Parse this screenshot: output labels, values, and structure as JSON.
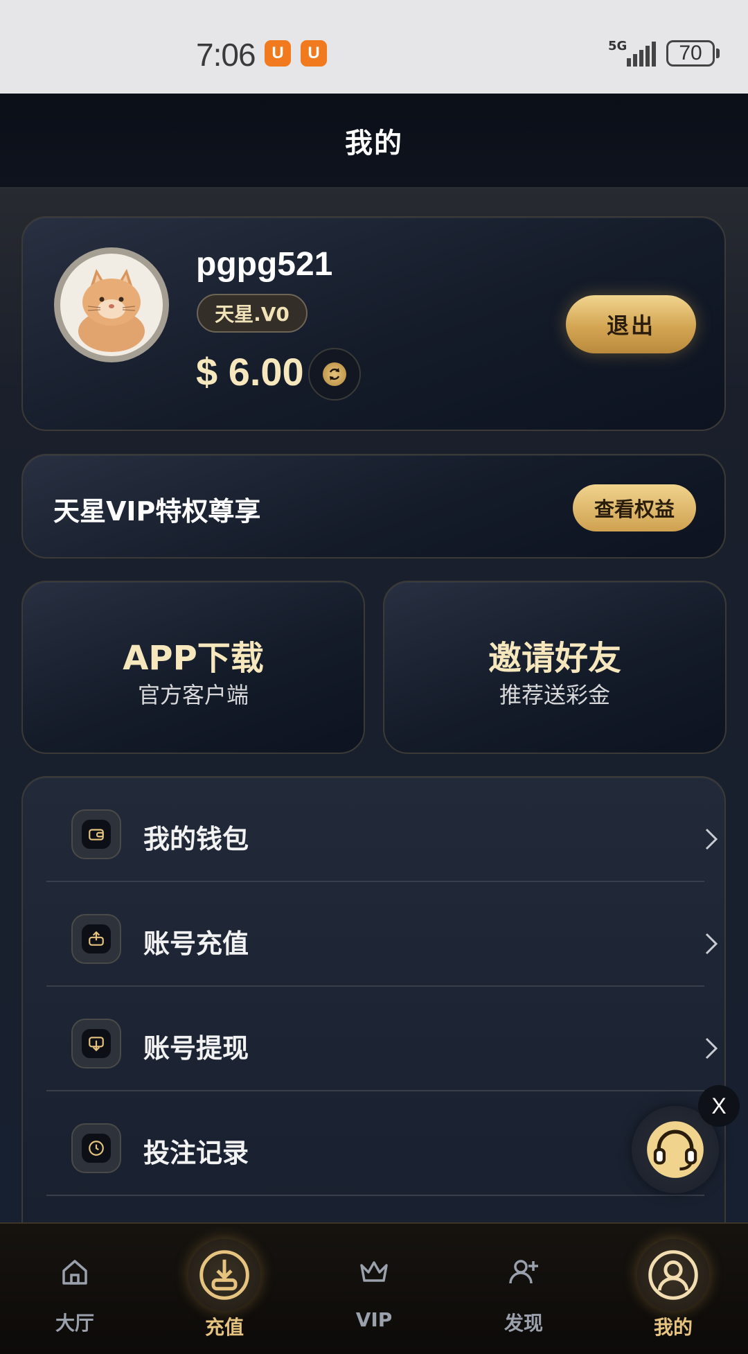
{
  "status_bar": {
    "time": "7:06",
    "app_icon_letter": "U",
    "network": "5G",
    "battery": "70"
  },
  "header": {
    "title": "我的"
  },
  "profile": {
    "username": "pgpg521",
    "level": "天星.V0",
    "balance": "$ 6.00",
    "logout_label": "退出"
  },
  "vip_banner": {
    "text": "天星VIP特权尊享",
    "button_label": "查看权益"
  },
  "tiles": [
    {
      "title": "APP下载",
      "subtitle": "官方客户端"
    },
    {
      "title": "邀请好友",
      "subtitle": "推荐送彩金"
    }
  ],
  "menu": [
    {
      "label": "我的钱包",
      "icon": "wallet-icon"
    },
    {
      "label": "账号充值",
      "icon": "upload-icon"
    },
    {
      "label": "账号提现",
      "icon": "download-icon"
    },
    {
      "label": "投注记录",
      "icon": "clock-icon"
    }
  ],
  "floating": {
    "close_label": "X",
    "icon": "headset-icon"
  },
  "tab_bar": [
    {
      "label": "大厅",
      "icon": "home-icon"
    },
    {
      "label": "充值",
      "icon": "download-icon"
    },
    {
      "label": "VIP",
      "icon": "crown-icon"
    },
    {
      "label": "发现",
      "icon": "add-user-icon"
    },
    {
      "label": "我的",
      "icon": "user-icon"
    }
  ],
  "colors": {
    "gold": "#e6c47f",
    "gold_button": "#d3a553",
    "background": "#141a26",
    "orange_app": "#f07a1d"
  }
}
